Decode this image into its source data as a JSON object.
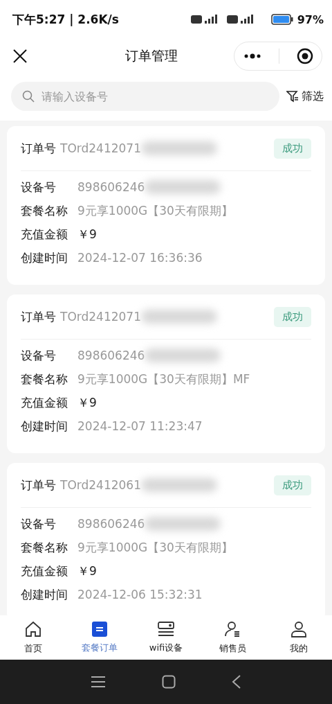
{
  "status_bar": {
    "time": "下午5:27 | 2.6K/s",
    "battery": "97%"
  },
  "nav": {
    "title": "订单管理"
  },
  "search": {
    "placeholder": "请输入设备号",
    "filter": "筛选"
  },
  "orders": [
    {
      "order_label": "订单号",
      "order_no": "TOrd2412071",
      "status": "成功",
      "fields": [
        {
          "label": "设备号",
          "value": "898606246"
        },
        {
          "label": "套餐名称",
          "value": "9元享1000G【30天有限期】"
        },
        {
          "label": "充值金额",
          "value": "￥9"
        },
        {
          "label": "创建时间",
          "value": "2024-12-07 16:36:36"
        }
      ]
    },
    {
      "order_label": "订单号",
      "order_no": "TOrd2412071",
      "status": "成功",
      "fields": [
        {
          "label": "设备号",
          "value": "898606246"
        },
        {
          "label": "套餐名称",
          "value": "9元享1000G【30天有限期】MF"
        },
        {
          "label": "充值金额",
          "value": "￥9"
        },
        {
          "label": "创建时间",
          "value": "2024-12-07 11:23:47"
        }
      ]
    },
    {
      "order_label": "订单号",
      "order_no": "TOrd2412061",
      "status": "成功",
      "fields": [
        {
          "label": "设备号",
          "value": "898606246"
        },
        {
          "label": "套餐名称",
          "value": "9元享1000G【30天有限期】"
        },
        {
          "label": "充值金额",
          "value": "￥9"
        },
        {
          "label": "创建时间",
          "value": "2024-12-06 15:32:31"
        }
      ]
    }
  ],
  "tabs": [
    {
      "label": "首页",
      "selected": false
    },
    {
      "label": "套餐订单",
      "selected": true
    },
    {
      "label": "wifi设备",
      "selected": false
    },
    {
      "label": "销售员",
      "selected": false
    },
    {
      "label": "我的",
      "selected": false
    }
  ]
}
